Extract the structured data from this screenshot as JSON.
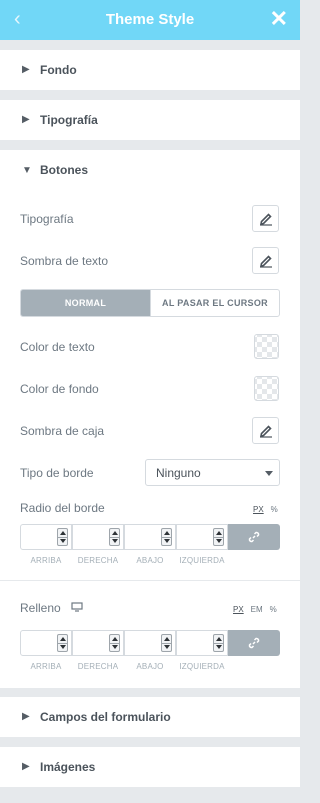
{
  "header": {
    "title": "Theme Style",
    "back_icon": "‹",
    "close_icon": "✕",
    "color": "#71d7f7"
  },
  "sections": {
    "fondo": "Fondo",
    "tipografia": "Tipografía",
    "botones": "Botones",
    "campos": "Campos del formulario",
    "imagenes": "Imágenes"
  },
  "botones": {
    "typography_label": "Tipografía",
    "text_shadow_label": "Sombra de texto",
    "tabs": {
      "normal": "NORMAL",
      "hover": "AL PASAR EL CURSOR"
    },
    "text_color_label": "Color de texto",
    "bg_color_label": "Color de fondo",
    "box_shadow_label": "Sombra de caja",
    "border_type_label": "Tipo de borde",
    "border_type_value": "Ninguno",
    "border_radius_label": "Radio del borde",
    "radius_units": [
      "PX",
      "%"
    ],
    "padding_label": "Relleno",
    "padding_units": [
      "PX",
      "EM",
      "%"
    ],
    "dimension_labels": [
      "ARRIBA",
      "DERECHA",
      "ABAJO",
      "IZQUIERDA"
    ]
  }
}
